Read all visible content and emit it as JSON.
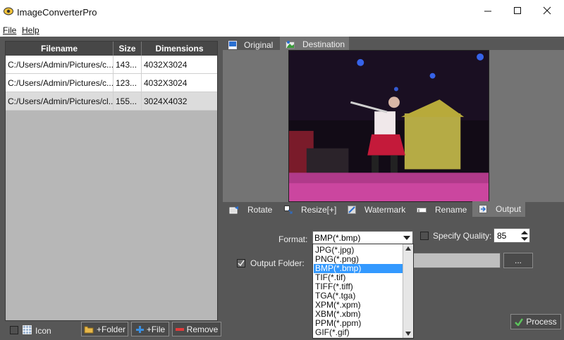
{
  "window": {
    "title": "ImageConverterPro"
  },
  "menu": {
    "file": "File",
    "help": "Help"
  },
  "table": {
    "headers": [
      "Filename",
      "Size",
      "Dimensions"
    ],
    "rows": [
      [
        "C:/Users/Admin/Pictures/c...",
        "143...",
        "4032X3024"
      ],
      [
        "C:/Users/Admin/Pictures/c...",
        "123...",
        "4032X3024"
      ],
      [
        "C:/Users/Admin/Pictures/cl...",
        "155...",
        "3024X4032"
      ]
    ]
  },
  "bottom": {
    "icon_label": "Icon",
    "add_folder": "+Folder",
    "add_file": "+File",
    "remove": "Remove"
  },
  "preview_tabs": {
    "original": "Original",
    "destination": "Destination"
  },
  "tool_tabs": {
    "rotate": "Rotate",
    "resize": "Resize[+]",
    "watermark": "Watermark",
    "rename": "Rename",
    "output": "Output"
  },
  "output": {
    "format_label": "Format:",
    "format_value": "BMP(*.bmp)",
    "specify_quality": "Specify Quality:",
    "quality_value": "85",
    "output_folder": "Output Folder:",
    "browse": "...",
    "process": "Process"
  },
  "format_options": [
    "JPG(*.jpg)",
    "PNG(*.png)",
    "BMP(*.bmp)",
    "TIF(*.tif)",
    "TIFF(*.tiff)",
    "TGA(*.tga)",
    "XPM(*.xpm)",
    "XBM(*.xbm)",
    "PPM(*.ppm)",
    "GIF(*.gif)"
  ],
  "selected_format_index": 2,
  "colors": {
    "accent": "#3399ff",
    "panel_dark": "#575757",
    "header": "#474747"
  }
}
